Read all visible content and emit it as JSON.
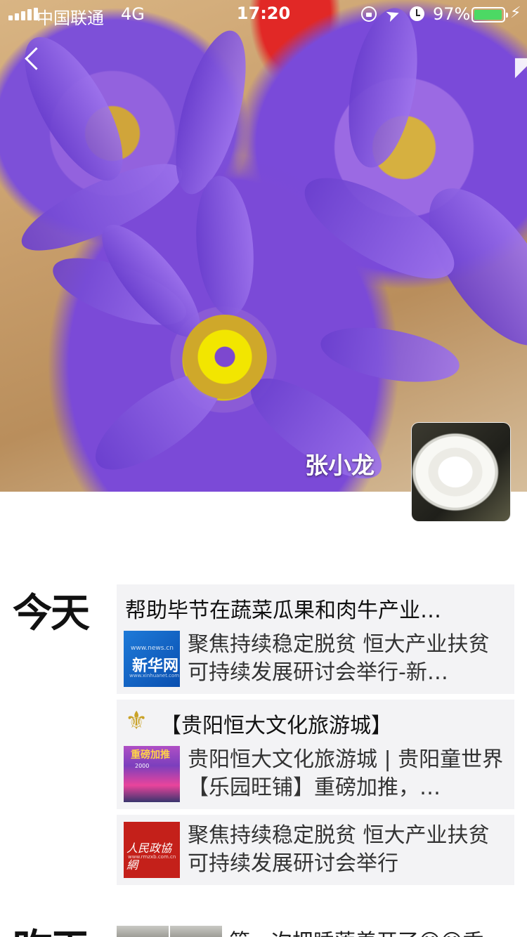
{
  "status_bar": {
    "carrier": "中国联通",
    "network": "4G",
    "time": "17:20",
    "battery_percent": "97%",
    "battery_level": 0.97
  },
  "cover": {
    "name": "张小龙"
  },
  "feed": {
    "today_label": "今天",
    "yesterday_label": "昨天",
    "posts": [
      {
        "title": "帮助毕节在蔬菜瓜果和肉牛产业…",
        "link_text": "聚焦持续稳定脱贫 恒大产业扶贫可持续发展研讨会举行-新…",
        "thumb_text": [
          "www.news.cn",
          "新华网",
          "www.xinhuanet.com"
        ]
      },
      {
        "title": "【贵阳恒大文化旅游城】",
        "link_text": "贵阳恒大文化旅游城 | 贵阳童世界【乐园旺铺】重磅加推，…",
        "thumb_text": [
          "重磅加推",
          "2000"
        ]
      },
      {
        "link_text": "聚焦持续稳定脱贫 恒大产业扶贫可持续发展研讨会举行",
        "thumb_text": [
          "人民政協網",
          "www.rmzxb.com.cn"
        ]
      }
    ],
    "yesterday_post_text": "第一次把睡莲养开了😊😊香"
  }
}
